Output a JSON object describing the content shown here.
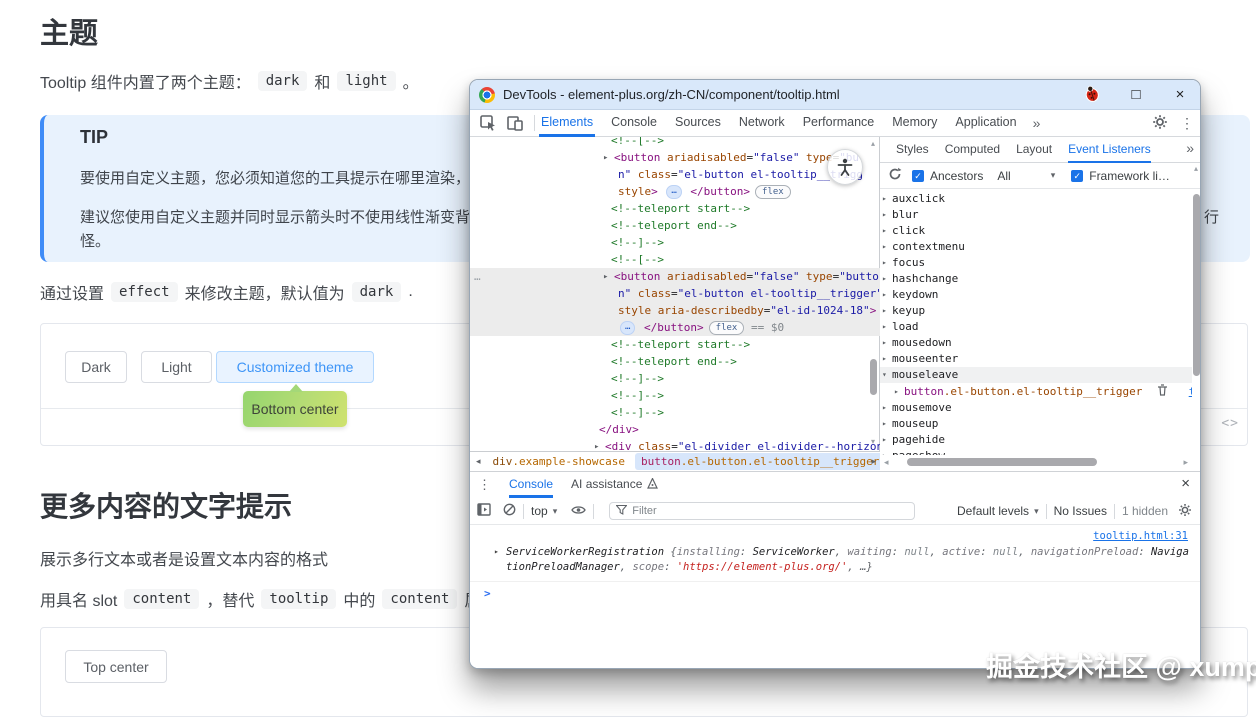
{
  "page": {
    "heading_theme": "主题",
    "intro": {
      "t1": "Tooltip 组件内置了两个主题：",
      "c1": "dark",
      "t2": "和",
      "c2": "light",
      "t3": "。"
    },
    "tip": {
      "title": "TIP",
      "p1": "要使用自定义主题，您必须知道您的工具提示在哪里渲染，如果",
      "p2": "建议您使用自定义主题并同时显示箭头时不使用线性渐变背景颜",
      "p2_sliver": "行",
      "p3": "怪。"
    },
    "effect_line": {
      "t1": "通过设置",
      "c1": "effect",
      "t2": "来修改主题，默认值为",
      "c2": "dark",
      "t3": "."
    },
    "demo1": {
      "btn_dark": "Dark",
      "btn_light": "Light",
      "btn_custom": "Customized theme",
      "tooltip": "Bottom center",
      "code_icon": "<>"
    },
    "heading_more": "更多内容的文字提示",
    "para_more": "展示多行文本或者是设置文本内容的格式",
    "slot_line": {
      "t1": "用具名 slot",
      "c1": "content",
      "t2": "，替代",
      "c2": "tooltip",
      "t3": "中的",
      "c3": "content",
      "t4": "属性。"
    },
    "demo2": {
      "btn": "Top center"
    }
  },
  "devtools": {
    "title": "DevTools - element-plus.org/zh-CN/component/tooltip.html",
    "window_controls": {
      "maximize": "□",
      "close": "×"
    },
    "tabs": [
      {
        "label": "Elements",
        "active": true
      },
      {
        "label": "Console"
      },
      {
        "label": "Sources"
      },
      {
        "label": "Network"
      },
      {
        "label": "Performance"
      },
      {
        "label": "Memory"
      },
      {
        "label": "Application"
      }
    ],
    "more_tabs": "»",
    "elements_lines": [
      {
        "ind": 141,
        "segs": [
          [
            "cm",
            "<!--[-->"
          ]
        ]
      },
      {
        "ind": 144,
        "ar": true,
        "segs": [
          [
            "tg",
            "<button"
          ],
          [
            "at",
            " ariadisabled"
          ],
          [
            "tx",
            "="
          ],
          [
            "av",
            "\"false\""
          ],
          [
            "at",
            " type"
          ],
          [
            "tx",
            "="
          ],
          [
            "av",
            "\"bu"
          ]
        ]
      },
      {
        "ind": 148,
        "segs": [
          [
            "av",
            "n\""
          ],
          [
            "at",
            " class"
          ],
          [
            "tx",
            "="
          ],
          [
            "av",
            "\"el-button el-tooltip__trigg"
          ]
        ]
      },
      {
        "ind": 148,
        "segs": [
          [
            "at",
            "style"
          ],
          [
            "tg",
            "> "
          ],
          [
            "ell",
            "…"
          ],
          [
            "tg",
            " </button>"
          ],
          [
            "badge",
            "flex"
          ]
        ]
      },
      {
        "ind": 141,
        "segs": [
          [
            "cm",
            "<!--teleport start-->"
          ]
        ]
      },
      {
        "ind": 141,
        "segs": [
          [
            "cm",
            "<!--teleport end-->"
          ]
        ]
      },
      {
        "ind": 141,
        "segs": [
          [
            "cm",
            "<!--]-->"
          ]
        ]
      },
      {
        "ind": 141,
        "segs": [
          [
            "cm",
            "<!--[-->"
          ]
        ]
      },
      {
        "ind": 144,
        "ar": true,
        "hl": true,
        "gut": "…",
        "segs": [
          [
            "tg",
            "<button"
          ],
          [
            "at",
            " ariadisabled"
          ],
          [
            "tx",
            "="
          ],
          [
            "av",
            "\"false\""
          ],
          [
            "at",
            " type"
          ],
          [
            "tx",
            "="
          ],
          [
            "av",
            "\"butto"
          ]
        ]
      },
      {
        "ind": 148,
        "hl": true,
        "segs": [
          [
            "av",
            "n\""
          ],
          [
            "at",
            " class"
          ],
          [
            "tx",
            "="
          ],
          [
            "av",
            "\"el-button el-tooltip__trigger\""
          ]
        ]
      },
      {
        "ind": 148,
        "hl": true,
        "segs": [
          [
            "at",
            "style"
          ],
          [
            "at",
            " aria-describedby"
          ],
          [
            "tx",
            "="
          ],
          [
            "av",
            "\"el-id-1024-18\""
          ],
          [
            "tg",
            ">"
          ]
        ]
      },
      {
        "ind": 148,
        "hl": true,
        "segs": [
          [
            "ell",
            "…"
          ],
          [
            "tg",
            " </button>"
          ],
          [
            "badge",
            "flex"
          ],
          [
            "gr",
            " == $0"
          ]
        ]
      },
      {
        "ind": 141,
        "segs": [
          [
            "cm",
            "<!--teleport start-->"
          ]
        ]
      },
      {
        "ind": 141,
        "segs": [
          [
            "cm",
            "<!--teleport end-->"
          ]
        ]
      },
      {
        "ind": 141,
        "segs": [
          [
            "cm",
            "<!--]-->"
          ]
        ]
      },
      {
        "ind": 141,
        "segs": [
          [
            "cm",
            "<!--]-->"
          ]
        ]
      },
      {
        "ind": 141,
        "segs": [
          [
            "cm",
            "<!--]-->"
          ]
        ]
      },
      {
        "ind": 129,
        "segs": [
          [
            "tg",
            "</div>"
          ]
        ]
      },
      {
        "ind": 135,
        "ar": true,
        "segs": [
          [
            "tg",
            "<div"
          ],
          [
            "at",
            " class"
          ],
          [
            "tx",
            "="
          ],
          [
            "av",
            "\"el-divider el-divider--horizont"
          ]
        ]
      }
    ],
    "breadcrumbs": [
      {
        "tag": "div",
        "cls": ".example-showcase"
      },
      {
        "tag": "button",
        "cls": ".el-button.el-tooltip__trigger",
        "selected": true
      }
    ],
    "right_panel": {
      "tabs": [
        {
          "label": "Styles"
        },
        {
          "label": "Computed"
        },
        {
          "label": "Layout"
        },
        {
          "label": "Event Listeners",
          "active": true
        }
      ],
      "ancestors_label": "Ancestors",
      "scope_value": "All",
      "framework_label": "Framework li…",
      "listeners": [
        "auxclick",
        "blur",
        "click",
        "contextmenu",
        "focus",
        "hashchange",
        "keydown",
        "keyup",
        "load",
        "mousedown",
        "mouseenter",
        "mouseleave",
        "mousemove",
        "mouseup",
        "pagehide",
        "pageshow"
      ],
      "expanded": "mouseleave",
      "listener_detail": {
        "tag": "button",
        "cls": ".el-button.el-tooltip__trigger",
        "link": "theme"
      }
    },
    "console": {
      "tabs": [
        {
          "label": "Console",
          "active": true
        },
        {
          "label": "AI assistance"
        }
      ],
      "context_value": "top",
      "filter_placeholder": "Filter",
      "levels_label": "Default levels",
      "no_issues": "No Issues",
      "hidden_count": "1 hidden",
      "source_link": "tooltip.html:31",
      "message": [
        [
          "obj",
          "ServiceWorkerRegistration"
        ],
        [
          "tx",
          " {"
        ],
        [
          "key",
          "installing"
        ],
        [
          "tx",
          ": "
        ],
        [
          "val",
          "ServiceWorker"
        ],
        [
          "tx",
          ", "
        ],
        [
          "key",
          "waiting"
        ],
        [
          "tx",
          ": "
        ],
        [
          "nul",
          "null"
        ],
        [
          "tx",
          ", "
        ],
        [
          "key",
          "active"
        ],
        [
          "tx",
          ": "
        ],
        [
          "nul",
          "null"
        ],
        [
          "tx",
          ", "
        ],
        [
          "key",
          "navigationPreload"
        ],
        [
          "tx",
          ": "
        ],
        [
          "val",
          "NavigationPreloadManager"
        ],
        [
          "tx",
          ", "
        ],
        [
          "key",
          "scope"
        ],
        [
          "tx",
          ": "
        ],
        [
          "str",
          "'https://element-plus.org/'"
        ],
        [
          "tx",
          ", "
        ],
        [
          "tx",
          "…}"
        ]
      ],
      "prompt": ">"
    }
  },
  "watermark": "掘金技术社区 @ xump",
  "colors": {
    "devtools_accent": "#1a73e8",
    "docs_primary": "#409eff",
    "tip_background": "#e8f2fd",
    "tooltip_gradient_start": "#95d56e",
    "tooltip_gradient_end": "#cfe26e",
    "titlebar": "#d9e8fa"
  },
  "icons": {
    "check": "✓",
    "dots_vertical": "⋮",
    "chevrons": "»",
    "arrow_right": "▸",
    "arrow_down": "▾",
    "arrow_up": "▴",
    "arrow_left": "◂",
    "close": "×",
    "maximize": "□",
    "ellipsis": "…"
  }
}
